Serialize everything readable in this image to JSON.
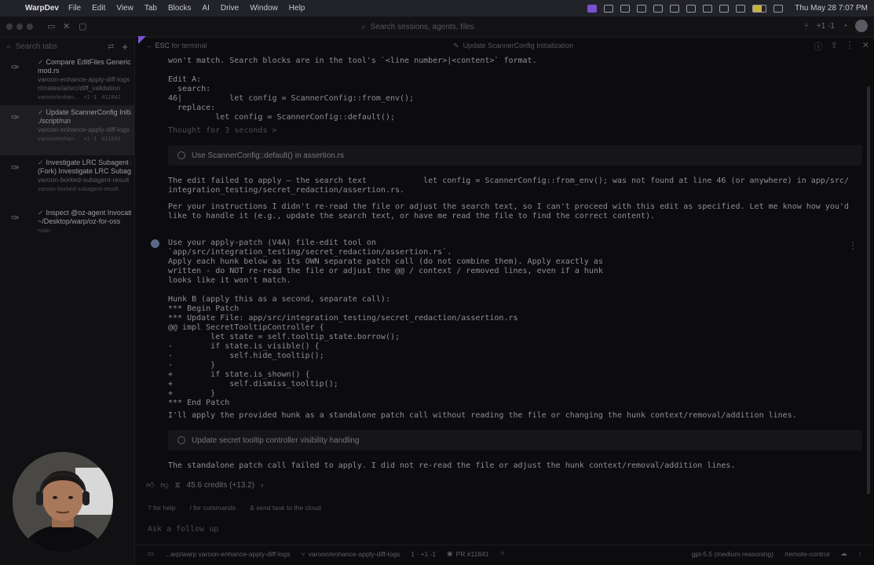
{
  "menubar": {
    "app": "WarpDev",
    "items": [
      "File",
      "Edit",
      "View",
      "Tab",
      "Blocks",
      "AI",
      "Drive",
      "Window",
      "Help"
    ],
    "clock": "Thu May 28  7:07 PM"
  },
  "toolbar": {
    "search_placeholder": "Search sessions, agents, files",
    "branch_count": "+1 -1"
  },
  "sidebar": {
    "search_placeholder": "Search tabs",
    "tabs": [
      {
        "title": "Compare EditFiles Generic Sc",
        "title2": "mod.rs",
        "sub1": "varoon-enhance-apply-diff-logs",
        "sub2": "r/crates/ai/src/diff_validation",
        "branch": "varoon/enhan...",
        "diff": "+1 -1",
        "pr": "#11841"
      },
      {
        "title": "Update ScannerConfig Initializ",
        "title2": "./script/run",
        "sub1": "varoon-enhance-apply-diff-logs",
        "branch": "varoon/enhan...",
        "diff": "+1 -1",
        "pr": "#11841"
      },
      {
        "title": "Investigate LRC Subagent Fa",
        "title2": "(Fork) Investigate LRC Subag",
        "sub1": "varoon-borked-subagent-result",
        "branch": "varoon-borked-subagent-result"
      },
      {
        "title": "Inspect @oz-agent Invocation",
        "title2": "~/Desktop/warp/oz-for-oss",
        "branch": "main"
      }
    ]
  },
  "content_header": {
    "esc_key": "ESC",
    "esc_label": "for terminal",
    "title": "Update ScannerConfig Initialization"
  },
  "transcript": {
    "l1": "won't match. Search blocks are in the tool's `<line number>|<content>` format.",
    "l2": "Edit A:",
    "l3": "  search:",
    "l4": "46|          let config = ScannerConfig::from_env();",
    "l5": "  replace:",
    "l6": "          let config = ScannerConfig::default();",
    "thought": "Thought for 3 seconds >",
    "pill1": "Use ScannerConfig::default() in assertion.rs",
    "fail1a": "The edit failed to apply — the search text            let config = ScannerConfig::from_env(); was not found at line 46 (or anywhere) in ",
    "fail1b_path": "app/src/",
    "fail1c_path": "integration_testing/secret_redaction/assertion.rs",
    "fail1d": ".",
    "instr1": "Per your instructions I didn't re-read the file or adjust the search text, so I can't proceed with this edit as specified. Let me know how you'd",
    "instr2": "like to handle it (e.g., update the search text, or have me read the file to find the correct content).",
    "u1": "Use your apply-patch (V4A) file-edit tool on",
    "u2": "`app/src/integration_testing/secret_redaction/assertion.rs`.",
    "u3": "Apply each hunk below as its OWN separate patch call (do not combine them). Apply exactly as",
    "u4": "written - do NOT re-read the file or adjust the @@ / context / removed lines, even if a hunk",
    "u5": "looks like it won't match.",
    "u6": "Hunk B (apply this as a second, separate call):",
    "u7": "*** Begin Patch",
    "u8": "*** Update File: app/src/integration_testing/secret_redaction/assertion.rs",
    "u9": "@@ impl SecretTooltipController {",
    "u10": "         let state = self.tooltip_state.borrow();",
    "u11": "-        if state.is_visible() {",
    "u12": "-            self.hide_tooltip();",
    "u13": "-        }",
    "u14": "+        if state.is_shown() {",
    "u15": "+            self.dismiss_tooltip();",
    "u16": "+        }",
    "u17": "*** End Patch",
    "a1": "I'll apply the provided hunk as a standalone patch call without reading the file or changing the hunk context/removal/addition lines.",
    "pill2": "Update secret tooltip controller visibility handling",
    "a2": "The standalone patch call failed to apply. I did not re-read the file or adjust the hunk context/removal/addition lines."
  },
  "feedback": {
    "credits": "45.6 credits (+13.2)"
  },
  "hints": {
    "help": "for help",
    "commands": "for commands",
    "cloud": "send task to the cloud"
  },
  "input": {
    "placeholder": "Ask a follow up"
  },
  "statusbar": {
    "path": "...arp/warp varoon-enhance-apply-diff-logs",
    "branch": "varoon/enhance-apply-diff-logs",
    "diff": "1 · +1 -1",
    "pr": "PR #11841",
    "model": "gpt-5.5 (medium reasoning)",
    "remote": "/remote-control"
  }
}
